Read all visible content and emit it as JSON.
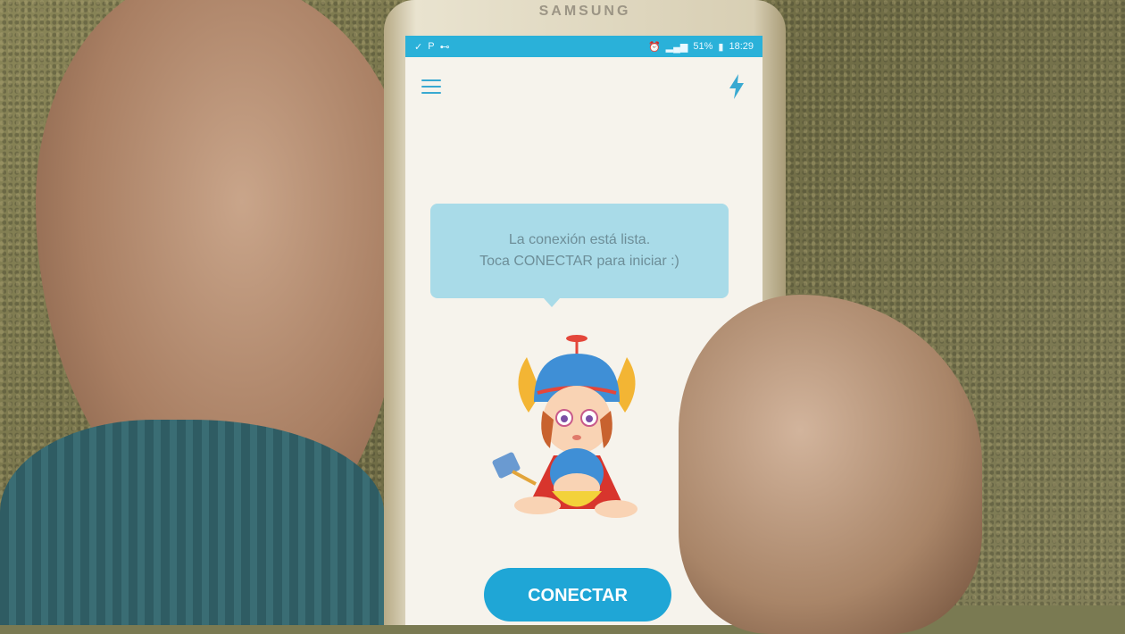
{
  "device": {
    "brand": "SAMSUNG"
  },
  "statusbar": {
    "left_icons": [
      "check-icon",
      "parking-icon",
      "key-icon"
    ],
    "battery": "51%",
    "time": "18:29"
  },
  "appbar": {
    "menu_icon": "menu-icon",
    "action_icon": "lightning-icon",
    "accent": "#39a9d1"
  },
  "message": {
    "line1": "La conexión está lista.",
    "line2": "Toca CONECTAR para iniciar :)"
  },
  "connect": {
    "label": "CONECTAR",
    "color": "#1fa6d6"
  }
}
